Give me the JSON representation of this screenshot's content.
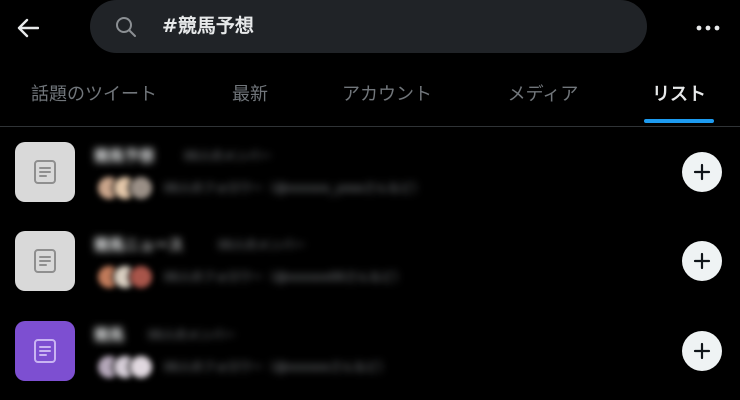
{
  "header": {
    "search_query": "#競馬予想"
  },
  "tabs": [
    {
      "label": "話題のツイート",
      "active": false
    },
    {
      "label": "最新",
      "active": false
    },
    {
      "label": "アカウント",
      "active": false
    },
    {
      "label": "メディア",
      "active": false
    },
    {
      "label": "リスト",
      "active": true
    }
  ],
  "lists": [
    {
      "title": "競馬予想",
      "members": "00人のメンバー",
      "meta": "00人のフォロワー（@xxxxxx_yosoさんなど）",
      "thumb_color": "#d9d9d9",
      "thumb_icon_color": "#8f8f8f",
      "avatar_colors": [
        "#c9a48a",
        "#e2c6a8",
        "#9a8f86"
      ]
    },
    {
      "title": "競馬ニュース",
      "members": "00人のメンバー",
      "meta": "00人のフォロワー（@xxxxxx00さんなど）",
      "thumb_color": "#d9d9d9",
      "thumb_icon_color": "#8f8f8f",
      "avatar_colors": [
        "#c07a5a",
        "#d8cdbf",
        "#a8554a"
      ]
    },
    {
      "title": "競馬",
      "members": "00人のメンバー",
      "meta": "00人のフォロワー（@xxxxxxさんなど）",
      "thumb_color": "#7d4fd1",
      "thumb_icon_color": "#c9b4f2",
      "avatar_colors": [
        "#b3a6b8",
        "#d4ccd6",
        "#e0d8df"
      ]
    }
  ],
  "colors": {
    "accent": "#1d9bf0",
    "background": "#000000",
    "search_bg": "#202327"
  }
}
